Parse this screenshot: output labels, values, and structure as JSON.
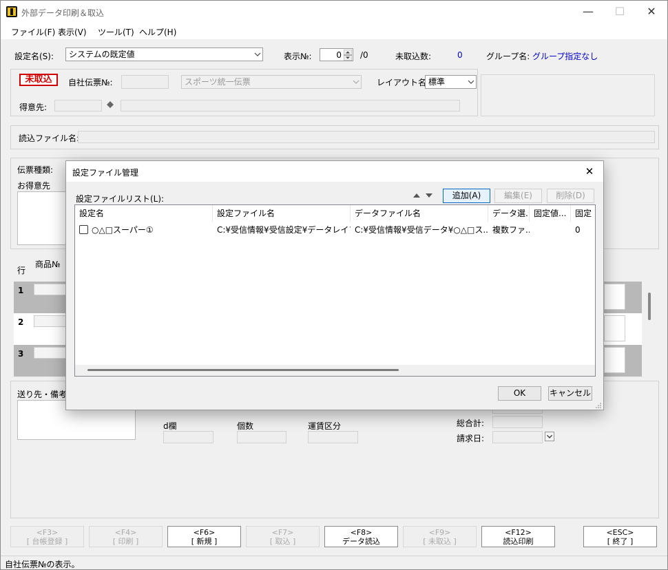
{
  "window": {
    "title": "外部データ印刷＆取込"
  },
  "menu": [
    "ファイル(F)",
    "表示(V)",
    "ツール(T)",
    "ヘルプ(H)"
  ],
  "top": {
    "setting_label": "設定名(S):",
    "setting_value": "システムの既定値",
    "display_no_label": "表示№:",
    "display_no_value": "0",
    "display_no_total": "/0",
    "unimported_label": "未取込数:",
    "unimported_value": "0",
    "group_label": "グループ名:",
    "group_value": "グループ指定なし"
  },
  "header": {
    "unread_badge": "未取込",
    "slip_no_label": "自社伝票№:",
    "slip_type_value": "スポーツ統一伝票",
    "layout_label": "レイアウト名:",
    "layout_value": "標準",
    "customer_label": "得意先:"
  },
  "file": {
    "label": "読込ファイル名:"
  },
  "slip": {
    "type_label": "伝票種類:",
    "customer_label": "お得意先"
  },
  "grid": {
    "row_header": "行",
    "product_header": "商品№",
    "rows": [
      "1",
      "2",
      "3"
    ]
  },
  "bottom": {
    "remarks_label": "送り先・備考",
    "d_label": "d欄",
    "qty_label": "個数",
    "freight_label": "運賃区分",
    "total_label": "総合計:",
    "billing_label": "請求日:"
  },
  "fkeys": [
    {
      "key": "<F3>",
      "label": "[ 台帳登録 ]",
      "enabled": false
    },
    {
      "key": "<F4>",
      "label": "[ 印刷 ]",
      "enabled": false
    },
    {
      "key": "<F6>",
      "label": "[ 新規 ]",
      "enabled": true
    },
    {
      "key": "<F7>",
      "label": "[ 取込 ]",
      "enabled": false
    },
    {
      "key": "<F8>",
      "label": "データ読込",
      "enabled": true
    },
    {
      "key": "<F9>",
      "label": "[ 未取込 ]",
      "enabled": false
    },
    {
      "key": "<F12>",
      "label": "読込印刷",
      "enabled": true
    },
    {
      "key": "<ESC>",
      "label": "[ 終了 ]",
      "enabled": true
    }
  ],
  "status": "自社伝票№の表示。",
  "dialog": {
    "title": "設定ファイル管理",
    "list_label": "設定ファイルリスト(L):",
    "add_button": "追加(A)",
    "edit_button": "編集(E)",
    "delete_button": "削除(D)",
    "columns": [
      "設定名",
      "設定ファイル名",
      "データファイル名",
      "データ選...",
      "固定値...",
      "固定"
    ],
    "rows": [
      {
        "name": "○△□スーパー①",
        "setting_file": "C:¥受信情報¥受信設定¥データレイア...",
        "data_file": "C:¥受信情報¥受信データ¥○△□ス...",
        "data_select": "複数ファ...",
        "fixed_value": "",
        "fixed": "0"
      }
    ],
    "ok_button": "OK",
    "cancel_button": "キャンセル"
  }
}
